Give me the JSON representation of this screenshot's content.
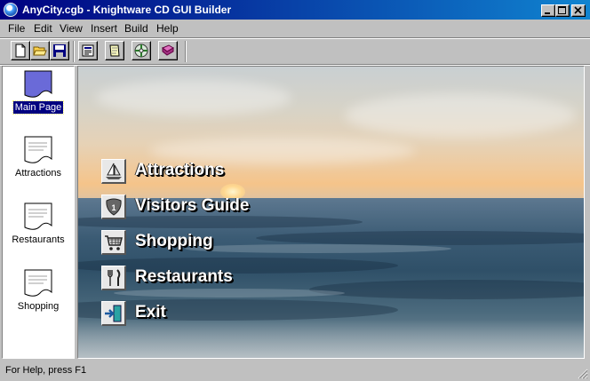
{
  "window": {
    "title": "AnyCity.cgb - Knightware CD GUI Builder"
  },
  "menubar": {
    "items": [
      "File",
      "Edit",
      "View",
      "Insert",
      "Build",
      "Help"
    ]
  },
  "toolbar": {
    "buttons": [
      "new-file-icon",
      "open-folder-icon",
      "save-disk-icon",
      "page-properties-icon",
      "notes-icon",
      "cd-build-icon",
      "help-book-icon"
    ]
  },
  "pages": {
    "items": [
      {
        "label": "Main Page",
        "selected": true
      },
      {
        "label": "Attractions",
        "selected": false
      },
      {
        "label": "Restaurants",
        "selected": false
      },
      {
        "label": "Shopping",
        "selected": false
      }
    ]
  },
  "canvas": {
    "buttons": [
      {
        "label": "Attractions",
        "icon": "sailboat-icon"
      },
      {
        "label": "Visitors Guide",
        "icon": "interstate-sign-icon"
      },
      {
        "label": "Shopping",
        "icon": "shopping-cart-icon"
      },
      {
        "label": "Restaurants",
        "icon": "fork-knife-icon"
      },
      {
        "label": "Exit",
        "icon": "exit-door-icon"
      }
    ]
  },
  "statusbar": {
    "text": "For Help, press F1"
  },
  "colors": {
    "titlebar_start": "#000080",
    "titlebar_end": "#1084d0",
    "face": "#c0c0c0",
    "selection": "#000080"
  }
}
